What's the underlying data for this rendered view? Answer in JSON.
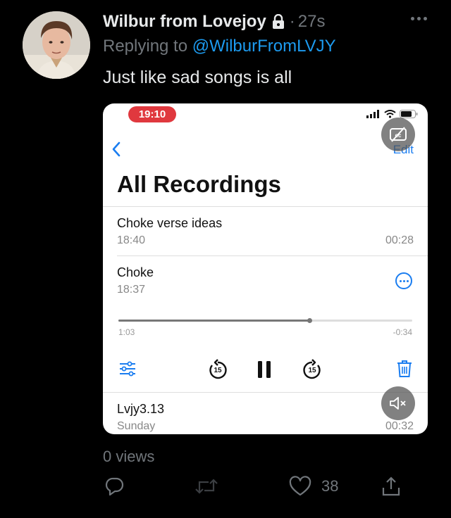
{
  "tweet": {
    "author": "Wilbur from Lovejoy",
    "separator": "·",
    "time": "27s",
    "replying_prefix": "Replying to ",
    "replying_handle": "@WilburFromLVJY",
    "text": "Just like sad songs is all",
    "views": "0 views",
    "like_count": "38"
  },
  "media": {
    "status_time": "19:10",
    "edit_label": "Edit",
    "title": "All Recordings",
    "recordings": [
      {
        "name": "Choke verse ideas",
        "date": "18:40",
        "duration": "00:28"
      },
      {
        "name": "Choke",
        "date": "18:37",
        "elapsed": "1:03",
        "remaining": "-0:34",
        "progress": 0.65
      },
      {
        "name": "Lvjy3.13",
        "date": "Sunday",
        "duration": "00:32"
      }
    ],
    "skip_label": "15"
  },
  "colors": {
    "twitter_blue": "#1d9bf0",
    "ios_blue": "#1a7df0",
    "recording_red": "#e0383e",
    "muted_text": "#71767b"
  }
}
